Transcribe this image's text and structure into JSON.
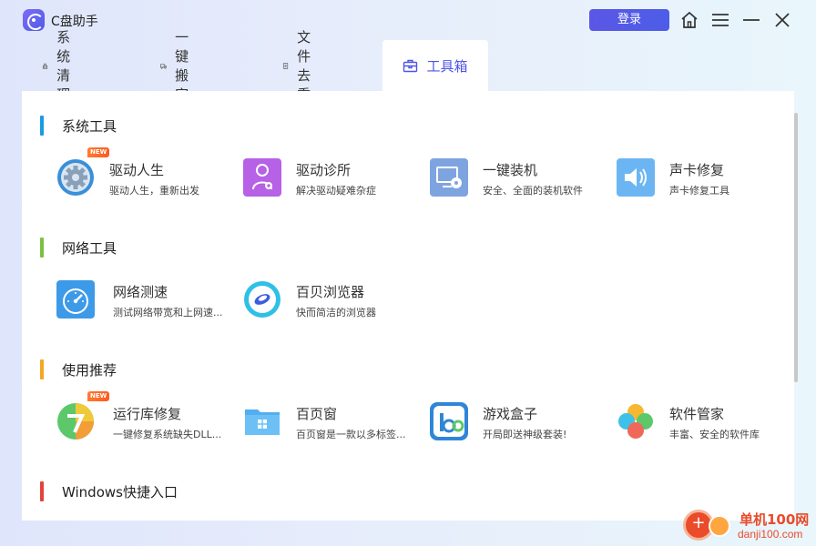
{
  "app": {
    "title": "C盘助手",
    "login_label": "登录"
  },
  "tabs": [
    {
      "label": "系统清理",
      "icon": "clean-icon",
      "active": false
    },
    {
      "label": "一键搬家",
      "icon": "truck-icon",
      "active": false
    },
    {
      "label": "文件去重",
      "icon": "document-icon",
      "active": false
    },
    {
      "label": "工具箱",
      "icon": "toolbox-icon",
      "active": true
    }
  ],
  "sections": [
    {
      "title": "系统工具",
      "accent": "#1a9be6",
      "tools": [
        {
          "name": "驱动人生",
          "desc": "驱动人生，重新出发",
          "icon": "gear-icon",
          "badge": "NEW"
        },
        {
          "name": "驱动诊所",
          "desc": "解决驱动疑难杂症",
          "icon": "doctor-icon"
        },
        {
          "name": "一键装机",
          "desc": "安全、全面的装机软件",
          "icon": "monitor-install-icon"
        },
        {
          "name": "声卡修复",
          "desc": "声卡修复工具",
          "icon": "speaker-icon"
        }
      ]
    },
    {
      "title": "网络工具",
      "accent": "#7cc142",
      "tools": [
        {
          "name": "网络测速",
          "desc": "测试网络带宽和上网速...",
          "icon": "speedometer-icon"
        },
        {
          "name": "百贝浏览器",
          "desc": "快而简洁的浏览器",
          "icon": "browser-icon"
        }
      ]
    },
    {
      "title": "使用推荐",
      "accent": "#f5a623",
      "tools": [
        {
          "name": "运行库修复",
          "desc": "一键修复系统缺失DLL...",
          "icon": "runtime-repair-icon",
          "badge": "NEW"
        },
        {
          "name": "百页窗",
          "desc": "百页窗是一款以多标签...",
          "icon": "folder-icon"
        },
        {
          "name": "游戏盒子",
          "desc": "开局即送神级套装!",
          "icon": "game-box-icon"
        },
        {
          "name": "软件管家",
          "desc": "丰富、安全的软件库",
          "icon": "software-manager-icon"
        }
      ]
    },
    {
      "title": "Windows快捷入口",
      "accent": "#e0443a",
      "tools": []
    }
  ],
  "watermark": {
    "text1": "单机100网",
    "text2": "danji100.com"
  }
}
